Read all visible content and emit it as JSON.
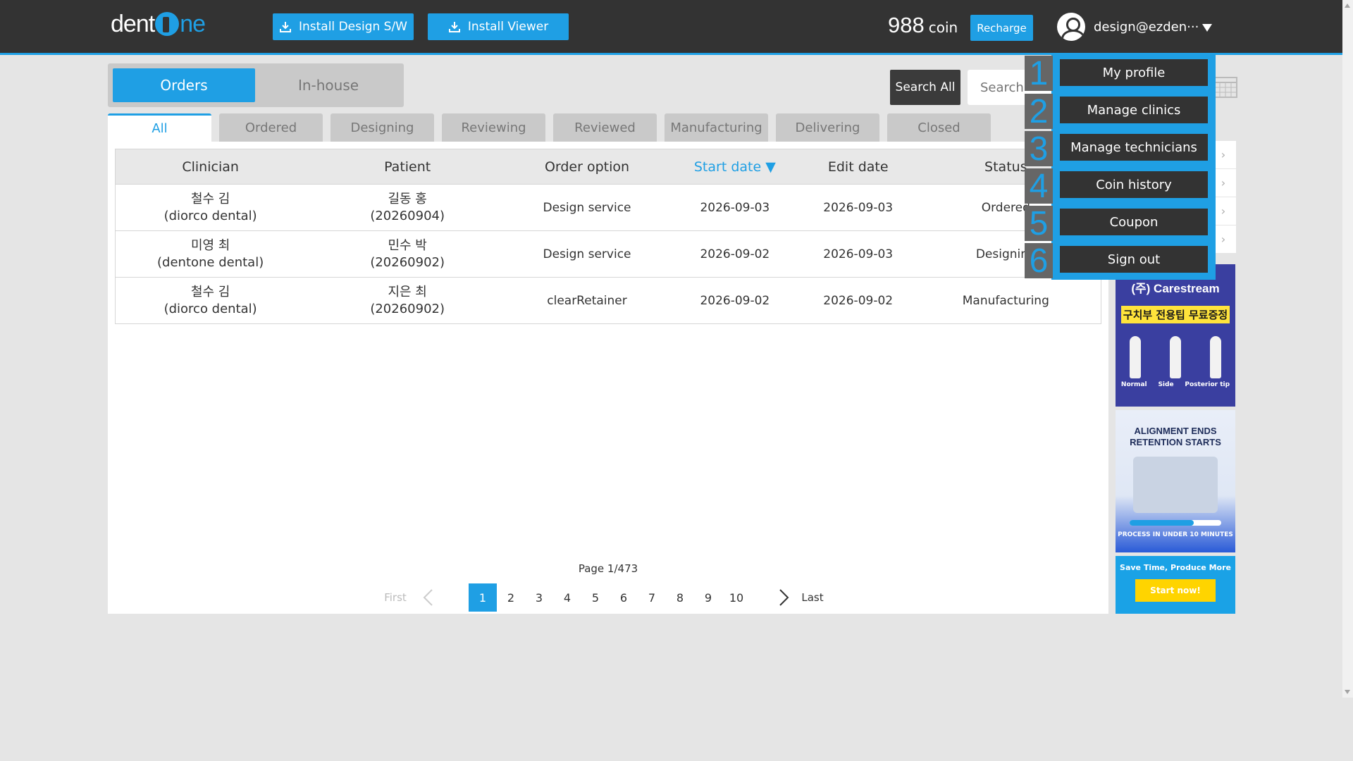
{
  "header": {
    "logo_left": "dent",
    "logo_right": "ne",
    "install_design": "Install Design S/W",
    "install_viewer": "Install Viewer",
    "coin_value": "988",
    "coin_unit": "coin",
    "recharge": "Recharge",
    "user_email": "design@ezden···"
  },
  "segments": {
    "orders": "Orders",
    "inhouse": "In-house"
  },
  "search": {
    "button": "Search All",
    "placeholder": "Search"
  },
  "tabs": [
    "All",
    "Ordered",
    "Designing",
    "Reviewing",
    "Reviewed",
    "Manufacturing",
    "Delivering",
    "Closed"
  ],
  "table": {
    "headers": [
      "Clinician",
      "Patient",
      "Order option",
      "Start date ▼",
      "Edit date",
      "Status"
    ],
    "rows": [
      {
        "clinician": "철수 김",
        "clinic": "(diorco dental)",
        "patient": "길동 홍",
        "patient_id": "(20260904)",
        "option": "Design service",
        "start": "2026-09-03",
        "edit": "2026-09-03",
        "status": "Ordered"
      },
      {
        "clinician": "미영 최",
        "clinic": "(dentone dental)",
        "patient": "민수 박",
        "patient_id": "(20260902)",
        "option": "Design service",
        "start": "2026-09-02",
        "edit": "2026-09-03",
        "status": "Designing"
      },
      {
        "clinician": "철수 김",
        "clinic": "(diorco dental)",
        "patient": "지은 최",
        "patient_id": "(20260902)",
        "option": "clearRetainer",
        "start": "2026-09-02",
        "edit": "2026-09-02",
        "status": "Manufacturing"
      }
    ]
  },
  "pagination": {
    "label": "Page 1/473",
    "first": "First",
    "last": "Last",
    "pages": [
      "1",
      "2",
      "3",
      "4",
      "5",
      "6",
      "7",
      "8",
      "9",
      "10"
    ],
    "current": "1"
  },
  "menu": {
    "items": [
      {
        "num": "1",
        "label": "My profile"
      },
      {
        "num": "2",
        "label": "Manage clinics"
      },
      {
        "num": "3",
        "label": "Manage technicians"
      },
      {
        "num": "4",
        "label": "Coin history"
      },
      {
        "num": "5",
        "label": "Coupon"
      },
      {
        "num": "6",
        "label": "Sign out"
      }
    ]
  },
  "ads": {
    "ad1_brand": "(주) Carestream",
    "ad1_promo": "구치부 전용팁 무료증정",
    "ad1_tips": [
      "Normal",
      "Side",
      "Posterior tip"
    ],
    "ad2_headline": "ALIGNMENT ENDS RETENTION STARTS",
    "ad2_process": "PROCESS IN UNDER 10 MINUTES",
    "ad3_tag": "Save Time, Produce More",
    "ad3_button": "Start now!"
  },
  "colors": {
    "accent": "#1f9fe4",
    "header_bg": "#333333",
    "page_bg": "#e5e5e5"
  }
}
